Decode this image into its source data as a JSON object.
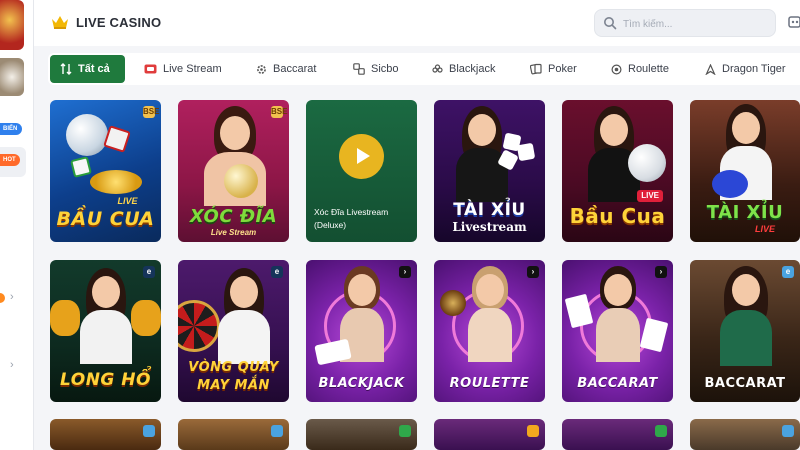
{
  "rail": {
    "new_badge": "BIỂN",
    "hot_badge": "HOT"
  },
  "header": {
    "title": "LIVE CASINO",
    "search_placeholder": "Tìm kiếm..."
  },
  "tabs": [
    {
      "label": "Tất cả",
      "icon": "all-icon"
    },
    {
      "label": "Live Stream",
      "icon": "live-icon"
    },
    {
      "label": "Baccarat",
      "icon": "gear-icon"
    },
    {
      "label": "Sicbo",
      "icon": "dice-icon"
    },
    {
      "label": "Blackjack",
      "icon": "clover-icon"
    },
    {
      "label": "Poker",
      "icon": "cards-icon"
    },
    {
      "label": "Roulette",
      "icon": "roulette-icon"
    },
    {
      "label": "Dragon Tiger",
      "icon": "dragon-icon"
    }
  ],
  "games_row1": [
    {
      "title": "BẦU CUA",
      "badge": "LIVE",
      "corner": "BSE"
    },
    {
      "title": "XÓC ĐĨA",
      "sub": "Live Stream",
      "corner": "BSE"
    },
    {
      "title_line1": "Xóc Đĩa Livestream",
      "title_line2": "(Deluxe)"
    },
    {
      "title": "TÀI XỈU",
      "sub": "Livestream"
    },
    {
      "title": "Bầu Cua",
      "badge": "LIVE"
    },
    {
      "title": "TÀI XỈU",
      "badge": "LIVE"
    }
  ],
  "games_row2": [
    {
      "title": "LONG HỔ",
      "corner": "e"
    },
    {
      "title_line1": "VÒNG QUAY",
      "title_line2": "MAY MẮN",
      "corner": "e"
    },
    {
      "title": "BLACKJACK",
      "corner": "›"
    },
    {
      "title": "ROULETTE",
      "corner": "›"
    },
    {
      "title": "BACCARAT",
      "corner": "›"
    },
    {
      "title": "BACCARAT",
      "corner": "e"
    }
  ],
  "colors": {
    "accent_green": "#1f7a3d",
    "hot_orange": "#ff6a2a",
    "new_blue": "#2f80ed",
    "gold": "#f6c531"
  }
}
